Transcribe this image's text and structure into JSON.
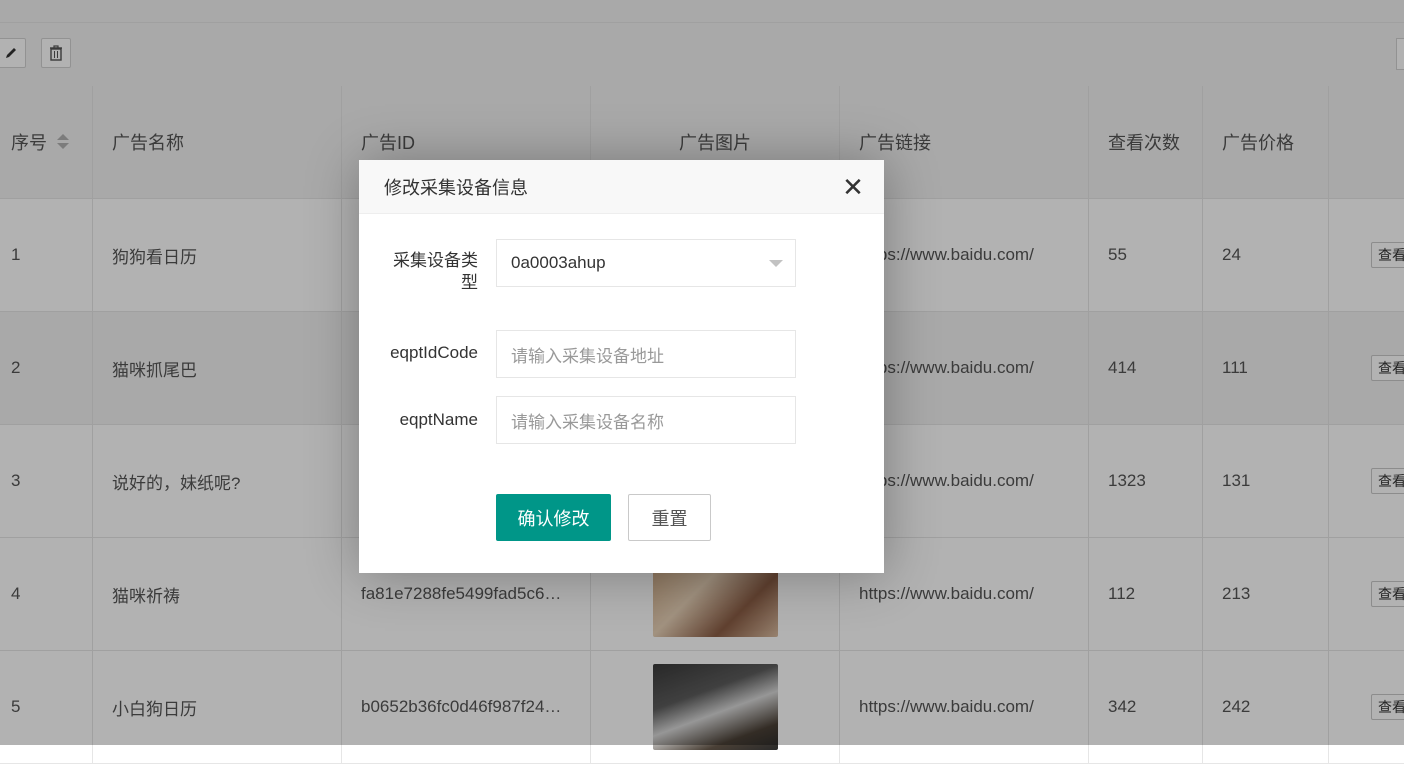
{
  "table": {
    "columns": [
      "序号",
      "广告名称",
      "广告ID",
      "广告图片",
      "广告链接",
      "查看次数",
      "广告价格"
    ],
    "rows": [
      {
        "no": "1",
        "name": "狗狗看日历",
        "id": "",
        "link": "https://www.baidu.com/",
        "views": "55",
        "price": "24",
        "action": "查看"
      },
      {
        "no": "2",
        "name": "猫咪抓尾巴",
        "id": "",
        "link": "https://www.baidu.com/",
        "views": "414",
        "price": "111",
        "action": "查看"
      },
      {
        "no": "3",
        "name": "说好的，妹纸呢?",
        "id": "",
        "link": "https://www.baidu.com/",
        "views": "1323",
        "price": "131",
        "action": "查看"
      },
      {
        "no": "4",
        "name": "猫咪祈祷",
        "id": "fa81e7288fe5499fad5c6…",
        "link": "https://www.baidu.com/",
        "views": "112",
        "price": "213",
        "action": "查看"
      },
      {
        "no": "5",
        "name": "小白狗日历",
        "id": "b0652b36fc0d46f987f24…",
        "link": "https://www.baidu.com/",
        "views": "342",
        "price": "242",
        "action": "查看"
      }
    ]
  },
  "modal": {
    "title": "修改采集设备信息",
    "fields": {
      "type_label": "采集设备类型",
      "type_value": "0a0003ahup",
      "code_label": "eqptIdCode",
      "code_placeholder": "请输入采集设备地址",
      "name_label": "eqptName",
      "name_placeholder": "请输入采集设备名称"
    },
    "confirm_label": "确认修改",
    "reset_label": "重置"
  },
  "colors": {
    "primary": "#009688",
    "header_bg": "#f2f2f2"
  }
}
